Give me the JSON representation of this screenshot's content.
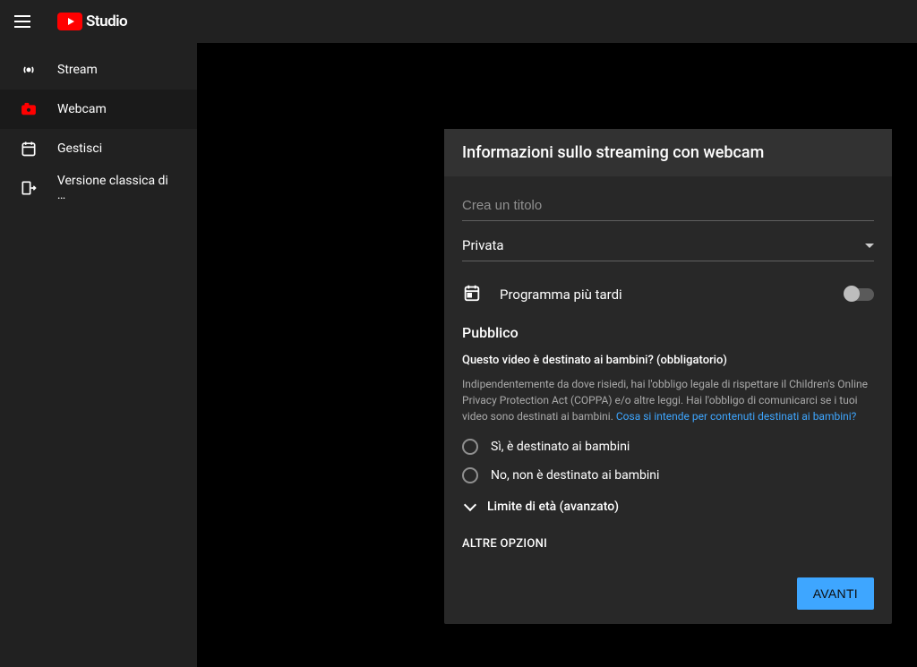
{
  "header": {
    "app_name": "Studio"
  },
  "sidebar": {
    "items": [
      {
        "label": "Stream"
      },
      {
        "label": "Webcam"
      },
      {
        "label": "Gestisci"
      },
      {
        "label": "Versione classica di …"
      }
    ]
  },
  "dialog": {
    "title": "Informazioni sullo streaming con webcam",
    "title_placeholder": "Crea un titolo",
    "privacy_value": "Privata",
    "schedule_label": "Programma più tardi",
    "audience_section_title": "Pubblico",
    "audience_question": "Questo video è destinato ai bambini? (obbligatorio)",
    "audience_desc": "Indipendentemente da dove risiedi, hai l'obbligo legale di rispettare il Children's Online Privacy Protection Act (COPPA) e/o altre leggi. Hai l'obbligo di comunicarci se i tuoi video sono destinati ai bambini. ",
    "audience_link": "Cosa si intende per contenuti destinati ai bambini?",
    "radio_yes": "Sì, è destinato ai bambini",
    "radio_no": "No, non è destinato ai bambini",
    "age_restriction_label": "Limite di età (avanzato)",
    "more_options": "ALTRE OPZIONI",
    "next_button": "AVANTI"
  }
}
